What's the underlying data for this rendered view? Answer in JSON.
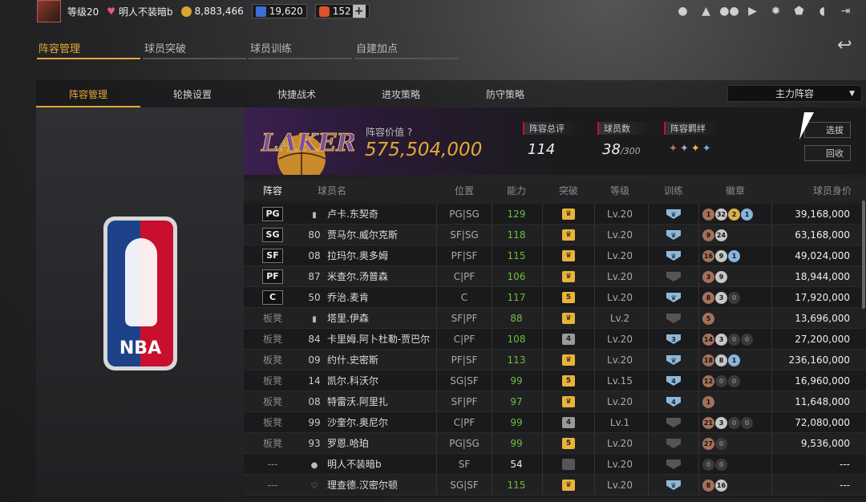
{
  "topbar": {
    "level": "等级20",
    "username": "明人不装暗b",
    "coins": "8,883,466",
    "stars": "19,620",
    "d_count": "152",
    "plus": "+"
  },
  "main_tabs": [
    "阵容管理",
    "球员突破",
    "球员训练",
    "自建加点"
  ],
  "sub_tabs": [
    "阵容管理",
    "轮换设置",
    "快捷战术",
    "进攻策略",
    "防守策略"
  ],
  "lineup_select": "主力阵容",
  "team": {
    "value_label": "阵容价值",
    "value": "575,504,000",
    "rating_label": "阵容总评",
    "rating": "114",
    "count_label": "球员数",
    "count": "38",
    "count_max": "/300",
    "bond_label": "阵容羁绊",
    "select_btn": "选拔",
    "recycle_btn": "回收"
  },
  "table": {
    "headers": [
      "阵容",
      "球员名",
      "位置",
      "能力",
      "突破",
      "等级",
      "训练",
      "徽章",
      "球员身价"
    ],
    "rows": [
      {
        "pos": "PG",
        "starter": true,
        "num": "ill",
        "name": "卢卡.东契奇",
        "place": "PG|SG",
        "ability": "129",
        "brk": "crown",
        "brk_color": "gold",
        "lv": "Lv.20",
        "tr": "♛",
        "tr_color": "blue",
        "badges": [
          [
            "1",
            "bronze"
          ],
          [
            "32",
            "silver"
          ],
          [
            "2",
            "gold"
          ],
          [
            "1",
            "blue"
          ]
        ],
        "value": "39,168,000"
      },
      {
        "pos": "SG",
        "starter": true,
        "num": "80",
        "name": "贾马尔.威尔克斯",
        "place": "SF|SG",
        "ability": "118",
        "brk": "crown",
        "brk_color": "gold",
        "lv": "Lv.20",
        "tr": "♛",
        "tr_color": "blue",
        "badges": [
          [
            "9",
            "bronze"
          ],
          [
            "24",
            "silver"
          ]
        ],
        "value": "63,168,000"
      },
      {
        "pos": "SF",
        "starter": true,
        "num": "08",
        "name": "拉玛尔.奥多姆",
        "place": "PF|SF",
        "ability": "115",
        "brk": "crown",
        "brk_color": "gold",
        "lv": "Lv.20",
        "tr": "♛",
        "tr_color": "blue",
        "badges": [
          [
            "16",
            "bronze"
          ],
          [
            "9",
            "silver"
          ],
          [
            "1",
            "blue"
          ]
        ],
        "value": "49,024,000"
      },
      {
        "pos": "PF",
        "starter": true,
        "num": "87",
        "name": "米查尔.汤普森",
        "place": "C|PF",
        "ability": "106",
        "brk": "crown",
        "brk_color": "gold",
        "lv": "Lv.20",
        "tr": "",
        "tr_color": "grey",
        "badges": [
          [
            "3",
            "bronze"
          ],
          [
            "9",
            "silver"
          ]
        ],
        "value": "18,944,000"
      },
      {
        "pos": "C",
        "starter": true,
        "num": "50",
        "name": "乔治.麦肯",
        "place": "C",
        "ability": "117",
        "brk": "5",
        "brk_color": "gold",
        "lv": "Lv.20",
        "tr": "♛",
        "tr_color": "blue",
        "badges": [
          [
            "8",
            "bronze"
          ],
          [
            "3",
            "silver"
          ],
          [
            "0",
            "dim"
          ]
        ],
        "value": "17,920,000"
      },
      {
        "pos": "板凳",
        "starter": false,
        "num": "ill",
        "name": "塔里.伊森",
        "place": "SF|PF",
        "ability": "88",
        "brk": "crown",
        "brk_color": "gold",
        "lv": "Lv.2",
        "tr": "",
        "tr_color": "grey",
        "badges": [
          [
            "5",
            "bronze"
          ]
        ],
        "value": "13,696,000"
      },
      {
        "pos": "板凳",
        "starter": false,
        "num": "84",
        "name": "卡里姆.阿卜杜勒-贾巴尔",
        "place": "C|PF",
        "ability": "108",
        "brk": "4",
        "brk_color": "silver",
        "lv": "Lv.20",
        "tr": "3",
        "tr_color": "blue",
        "badges": [
          [
            "14",
            "bronze"
          ],
          [
            "3",
            "silver"
          ],
          [
            "0",
            "dim"
          ],
          [
            "0",
            "dim"
          ]
        ],
        "value": "27,200,000"
      },
      {
        "pos": "板凳",
        "starter": false,
        "num": "09",
        "name": "约什.史密斯",
        "place": "PF|SF",
        "ability": "113",
        "brk": "crown",
        "brk_color": "gold",
        "lv": "Lv.20",
        "tr": "♛",
        "tr_color": "blue",
        "badges": [
          [
            "18",
            "bronze"
          ],
          [
            "8",
            "silver"
          ],
          [
            "1",
            "blue"
          ]
        ],
        "value": "236,160,000"
      },
      {
        "pos": "板凳",
        "starter": false,
        "num": "14",
        "name": "凯尔.科沃尔",
        "place": "SG|SF",
        "ability": "99",
        "brk": "5",
        "brk_color": "gold",
        "lv": "Lv.15",
        "tr": "4",
        "tr_color": "blue",
        "badges": [
          [
            "12",
            "bronze"
          ],
          [
            "0",
            "dim"
          ],
          [
            "0",
            "dim"
          ]
        ],
        "value": "16,960,000"
      },
      {
        "pos": "板凳",
        "starter": false,
        "num": "08",
        "name": "特雷沃.阿里扎",
        "place": "SF|PF",
        "ability": "97",
        "brk": "crown",
        "brk_color": "gold",
        "lv": "Lv.20",
        "tr": "4",
        "tr_color": "blue",
        "badges": [
          [
            "1",
            "bronze"
          ]
        ],
        "value": "11,648,000"
      },
      {
        "pos": "板凳",
        "starter": false,
        "num": "99",
        "name": "沙奎尔.奥尼尔",
        "place": "C|PF",
        "ability": "99",
        "brk": "4",
        "brk_color": "silver",
        "lv": "Lv.1",
        "tr": "",
        "tr_color": "grey",
        "badges": [
          [
            "21",
            "bronze"
          ],
          [
            "3",
            "silver"
          ],
          [
            "0",
            "dim"
          ],
          [
            "0",
            "dim"
          ]
        ],
        "value": "72,080,000"
      },
      {
        "pos": "板凳",
        "starter": false,
        "num": "93",
        "name": "罗恩.哈珀",
        "place": "PG|SG",
        "ability": "99",
        "brk": "5",
        "brk_color": "gold",
        "lv": "Lv.20",
        "tr": "",
        "tr_color": "grey",
        "badges": [
          [
            "27",
            "bronze"
          ],
          [
            "0",
            "dim"
          ]
        ],
        "value": "9,536,000"
      },
      {
        "pos": "---",
        "starter": false,
        "num": "user",
        "name": "明人不装暗b",
        "place": "SF",
        "ability": "54",
        "brk": "",
        "brk_color": "dark",
        "lv": "Lv.20",
        "tr": "",
        "tr_color": "grey",
        "badges": [
          [
            "0",
            "dim"
          ],
          [
            "0",
            "dim"
          ]
        ],
        "value": "---"
      },
      {
        "pos": "---",
        "starter": false,
        "num": "pin",
        "name": "理查德.汉密尔顿",
        "place": "SG|SF",
        "ability": "115",
        "brk": "crown",
        "brk_color": "gold",
        "lv": "Lv.20",
        "tr": "♛",
        "tr_color": "blue",
        "badges": [
          [
            "8",
            "bronze"
          ],
          [
            "16",
            "silver"
          ]
        ],
        "value": "---"
      }
    ]
  },
  "colors": {
    "accent": "#e3a937",
    "green": "#6cbf3a"
  }
}
